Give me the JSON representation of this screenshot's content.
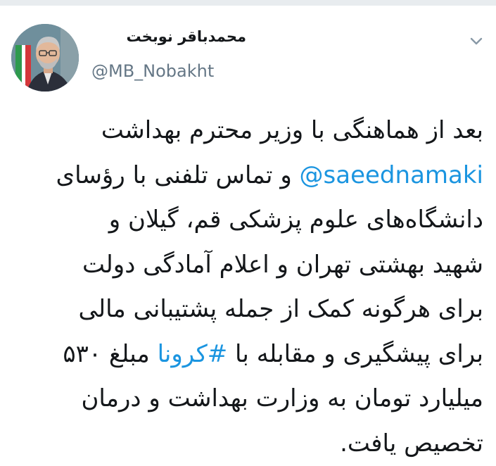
{
  "author": {
    "display_name": "محمدباقر نوبخت",
    "handle": "@MB_Nobakht"
  },
  "icons": {
    "menu": "chevron-down-icon",
    "avatar": "profile-photo"
  },
  "colors": {
    "text": "#14171a",
    "secondary": "#657786",
    "link": "#1b95e0"
  },
  "tweet": {
    "line1": "بعد از هماهنگی با وزیر محترم بهداشت",
    "line2_mention": "@saeednamaki",
    "line2_rest": " و تماس تلفنی با رؤسای",
    "line3": "دانشگاه‌های علوم پزشکی قم، گیلان و",
    "line4": "شهید بهشتی تهران و اعلام آمادگی دولت",
    "line5": "برای هرگونه کمک از جمله پشتیبانی مالی",
    "line6_before": "برای پیشگیری و مقابله با ",
    "line6_hashtag": "#کرونا",
    "line6_after": " مبلغ ۵۳۰",
    "line7": "میلیارد تومان به وزارت بهداشت و درمان",
    "line8": "تخصیص یافت."
  }
}
